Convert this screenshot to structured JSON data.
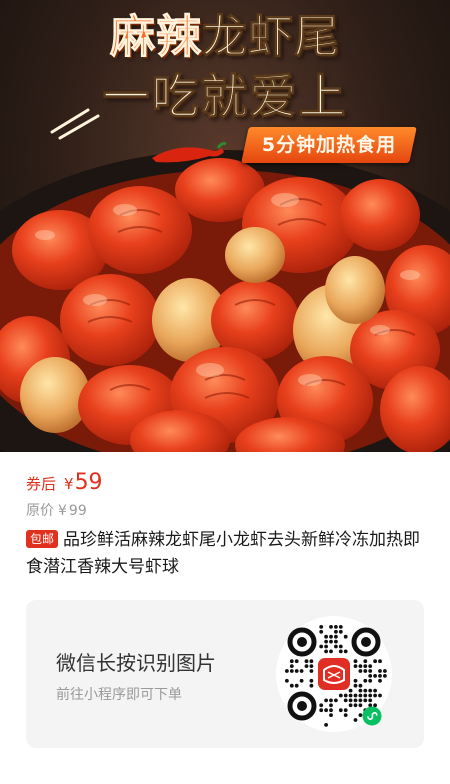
{
  "hero": {
    "title_hot": "麻辣",
    "title_name": "龙虾尾",
    "subtitle": "一吃就爱上",
    "badge": "5分钟加热食用"
  },
  "price": {
    "label": "券后",
    "currency": "¥",
    "value": "59",
    "original_label": "原价",
    "original_currency": "¥",
    "original_value": "99"
  },
  "product": {
    "tag": "包邮",
    "title": "品珍鲜活麻辣龙虾尾小龙虾去头新鲜冷冻加热即食潜江香辣大号虾球"
  },
  "qr": {
    "title": "微信长按识别图片",
    "subtitle": "前往小程序即可下单"
  },
  "colors": {
    "accent": "#e0301e",
    "muted": "#9a9a9a",
    "card_bg": "#f4f4f4",
    "qr_center": "#e02e24"
  },
  "icons": {
    "brand": "pinduoduo-logo-icon",
    "miniprogram": "wechat-miniprogram-icon"
  }
}
